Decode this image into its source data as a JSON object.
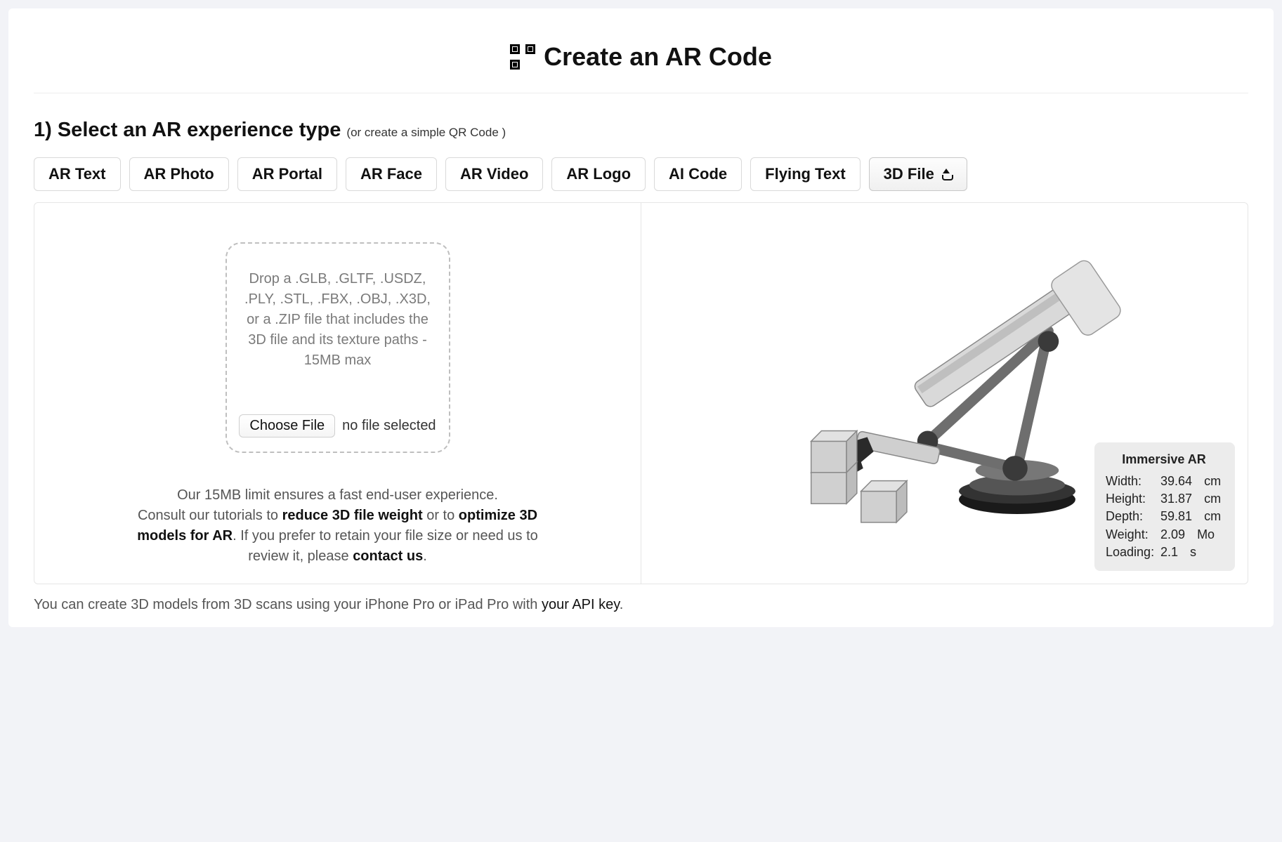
{
  "header": {
    "title": "Create an AR Code",
    "icon": "qr-icon"
  },
  "step1": {
    "heading": "1) Select an AR experience type",
    "paren_prefix": "(or create a ",
    "paren_link": "simple QR Code",
    "paren_suffix": " )"
  },
  "tabs": [
    {
      "id": "ar-text",
      "label": "AR Text",
      "active": false
    },
    {
      "id": "ar-photo",
      "label": "AR Photo",
      "active": false
    },
    {
      "id": "ar-portal",
      "label": "AR Portal",
      "active": false
    },
    {
      "id": "ar-face",
      "label": "AR Face",
      "active": false
    },
    {
      "id": "ar-video",
      "label": "AR Video",
      "active": false
    },
    {
      "id": "ar-logo",
      "label": "AR Logo",
      "active": false
    },
    {
      "id": "ai-code",
      "label": "AI Code",
      "active": false
    },
    {
      "id": "flying-text",
      "label": "Flying Text",
      "active": false
    },
    {
      "id": "3d-file",
      "label": "3D File",
      "active": true,
      "icon": "upload-icon"
    }
  ],
  "dropzone": {
    "text": "Drop a .GLB, .GLTF, .USDZ, .PLY, .STL, .FBX, .OBJ, .X3D, or a .ZIP file that includes the 3D file and its texture paths - 15MB max",
    "choose_label": "Choose File",
    "no_file_label": "no file selected"
  },
  "note": {
    "line1": "Our 15MB limit ensures a fast end-user experience.",
    "line2_prefix": "Consult our tutorials to ",
    "reduce_link": "reduce 3D file weight",
    "line2_mid": " or to ",
    "optimize_link": "optimize 3D models for AR",
    "line2_suffix": ". If you prefer to retain your file size or need us to review it, please ",
    "contact_link": "contact us",
    "period": "."
  },
  "preview": {
    "title": "Immersive AR",
    "rows": {
      "width": {
        "label": "Width:",
        "value": "39.64",
        "unit": "cm"
      },
      "height": {
        "label": "Height:",
        "value": "31.87",
        "unit": "cm"
      },
      "depth": {
        "label": "Depth:",
        "value": "59.81",
        "unit": "cm"
      },
      "weight": {
        "label": "Weight:",
        "value": "2.09",
        "unit": "Mo"
      },
      "loading": {
        "label": "Loading:",
        "value": "2.1",
        "unit": "s"
      }
    }
  },
  "footer": {
    "text_prefix": "You can create 3D models from 3D scans using your iPhone Pro or iPad Pro with ",
    "link": "your API key",
    "text_suffix": "."
  }
}
